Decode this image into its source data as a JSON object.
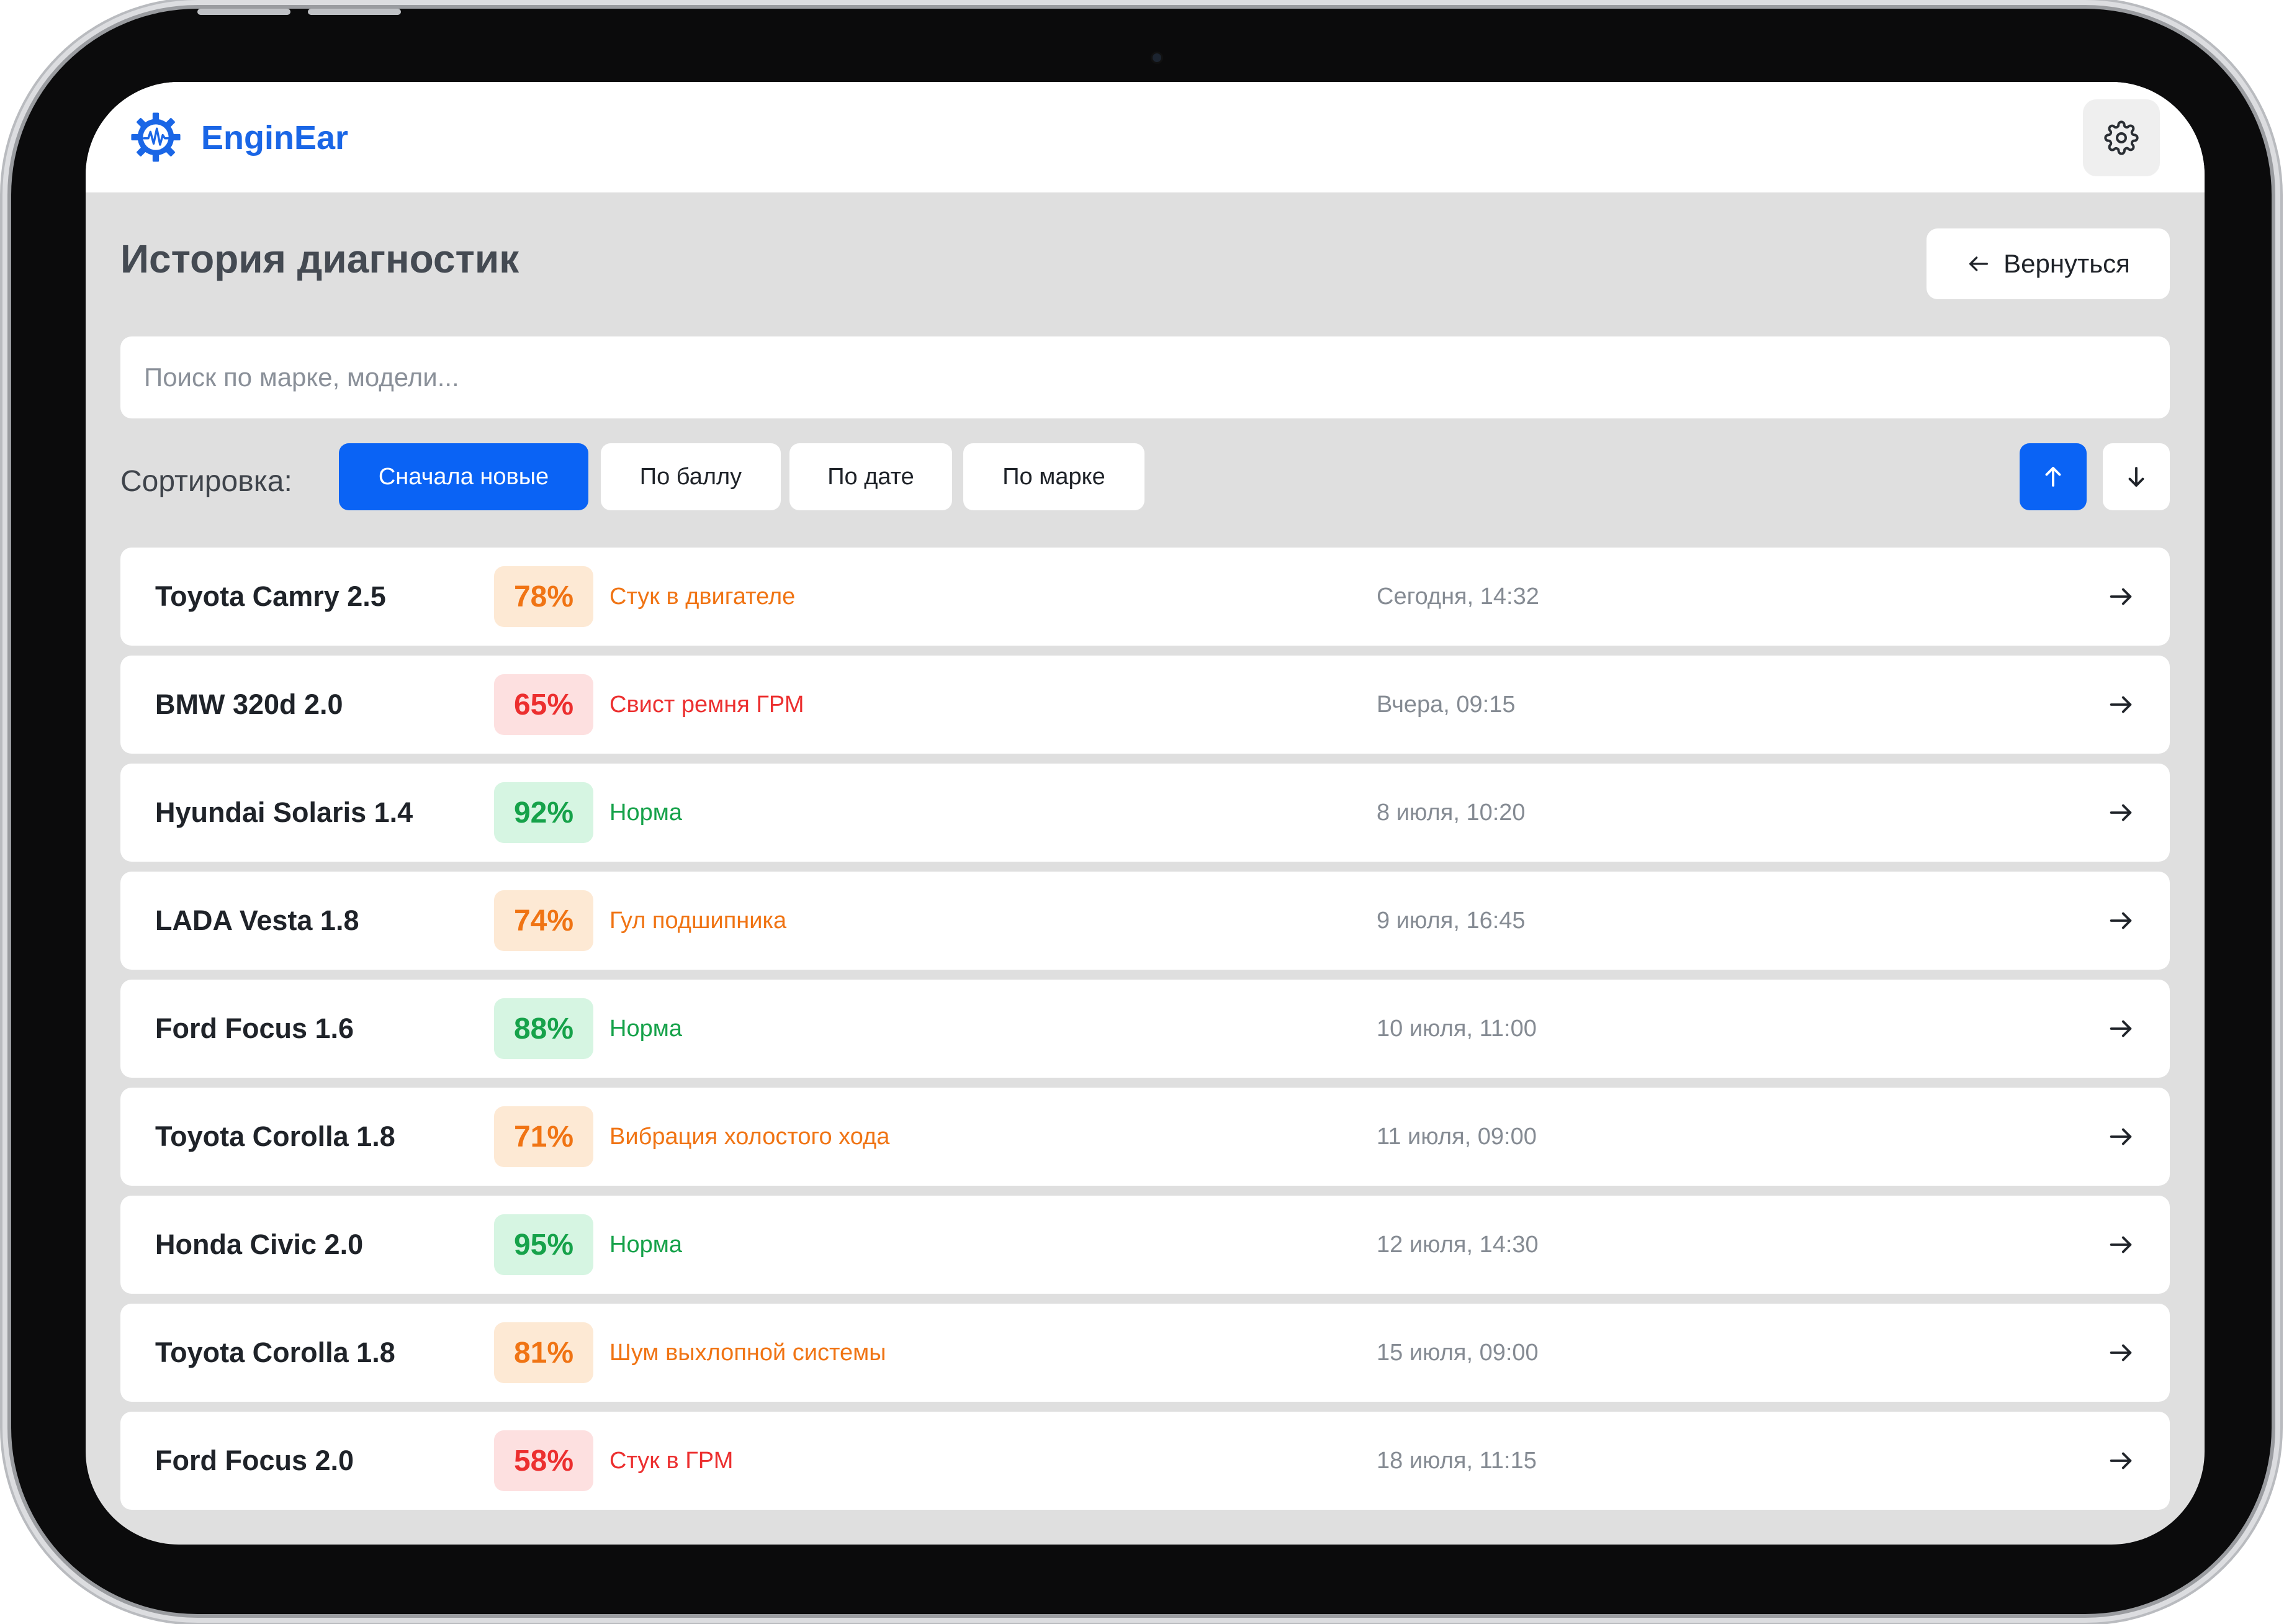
{
  "app": {
    "brand": "EnginEar",
    "logo_icon": "gear-waveform-icon",
    "settings_icon": "gear-icon"
  },
  "page": {
    "title": "История диагностик",
    "back_label": "Вернуться",
    "back_icon": "arrow-left-icon"
  },
  "search": {
    "placeholder": "Поиск по марке, модели..."
  },
  "sort": {
    "label": "Сортировка:",
    "options": [
      "Сначала новые",
      "По баллу",
      "По дате",
      "По марке"
    ],
    "active_option": "Сначала новые",
    "direction_asc_icon": "arrow-up-icon",
    "direction_desc_icon": "arrow-down-icon",
    "active_direction": "asc"
  },
  "colors": {
    "accent": "#0a63f5",
    "warn": "#f07414",
    "bad": "#ec2f2f",
    "ok": "#16a24a"
  },
  "diagnostics": [
    {
      "car": "Toyota Camry 2.5",
      "score": "78%",
      "issue": "Стук в двигателе",
      "date": "Сегодня, 14:32",
      "severity": "warn"
    },
    {
      "car": "BMW 320d 2.0",
      "score": "65%",
      "issue": "Свист ремня ГРМ",
      "date": "Вчера, 09:15",
      "severity": "bad"
    },
    {
      "car": "Hyundai Solaris 1.4",
      "score": "92%",
      "issue": "Норма",
      "date": "8 июля, 10:20",
      "severity": "ok"
    },
    {
      "car": "LADA Vesta 1.8",
      "score": "74%",
      "issue": "Гул подшипника",
      "date": "9 июля, 16:45",
      "severity": "warn"
    },
    {
      "car": "Ford Focus 1.6",
      "score": "88%",
      "issue": "Норма",
      "date": "10 июля, 11:00",
      "severity": "ok"
    },
    {
      "car": "Toyota Corolla 1.8",
      "score": "71%",
      "issue": "Вибрация холостого хода",
      "date": "11 июля, 09:00",
      "severity": "warn"
    },
    {
      "car": "Honda Civic 2.0",
      "score": "95%",
      "issue": "Норма",
      "date": "12 июля, 14:30",
      "severity": "ok"
    },
    {
      "car": "Toyota Corolla 1.8",
      "score": "81%",
      "issue": "Шум выхлопной системы",
      "date": "15 июля, 09:00",
      "severity": "warn"
    },
    {
      "car": "Ford Focus 2.0",
      "score": "58%",
      "issue": "Стук в ГРМ",
      "date": "18 июля, 11:15",
      "severity": "bad"
    }
  ],
  "row_action_icon": "arrow-right-icon"
}
